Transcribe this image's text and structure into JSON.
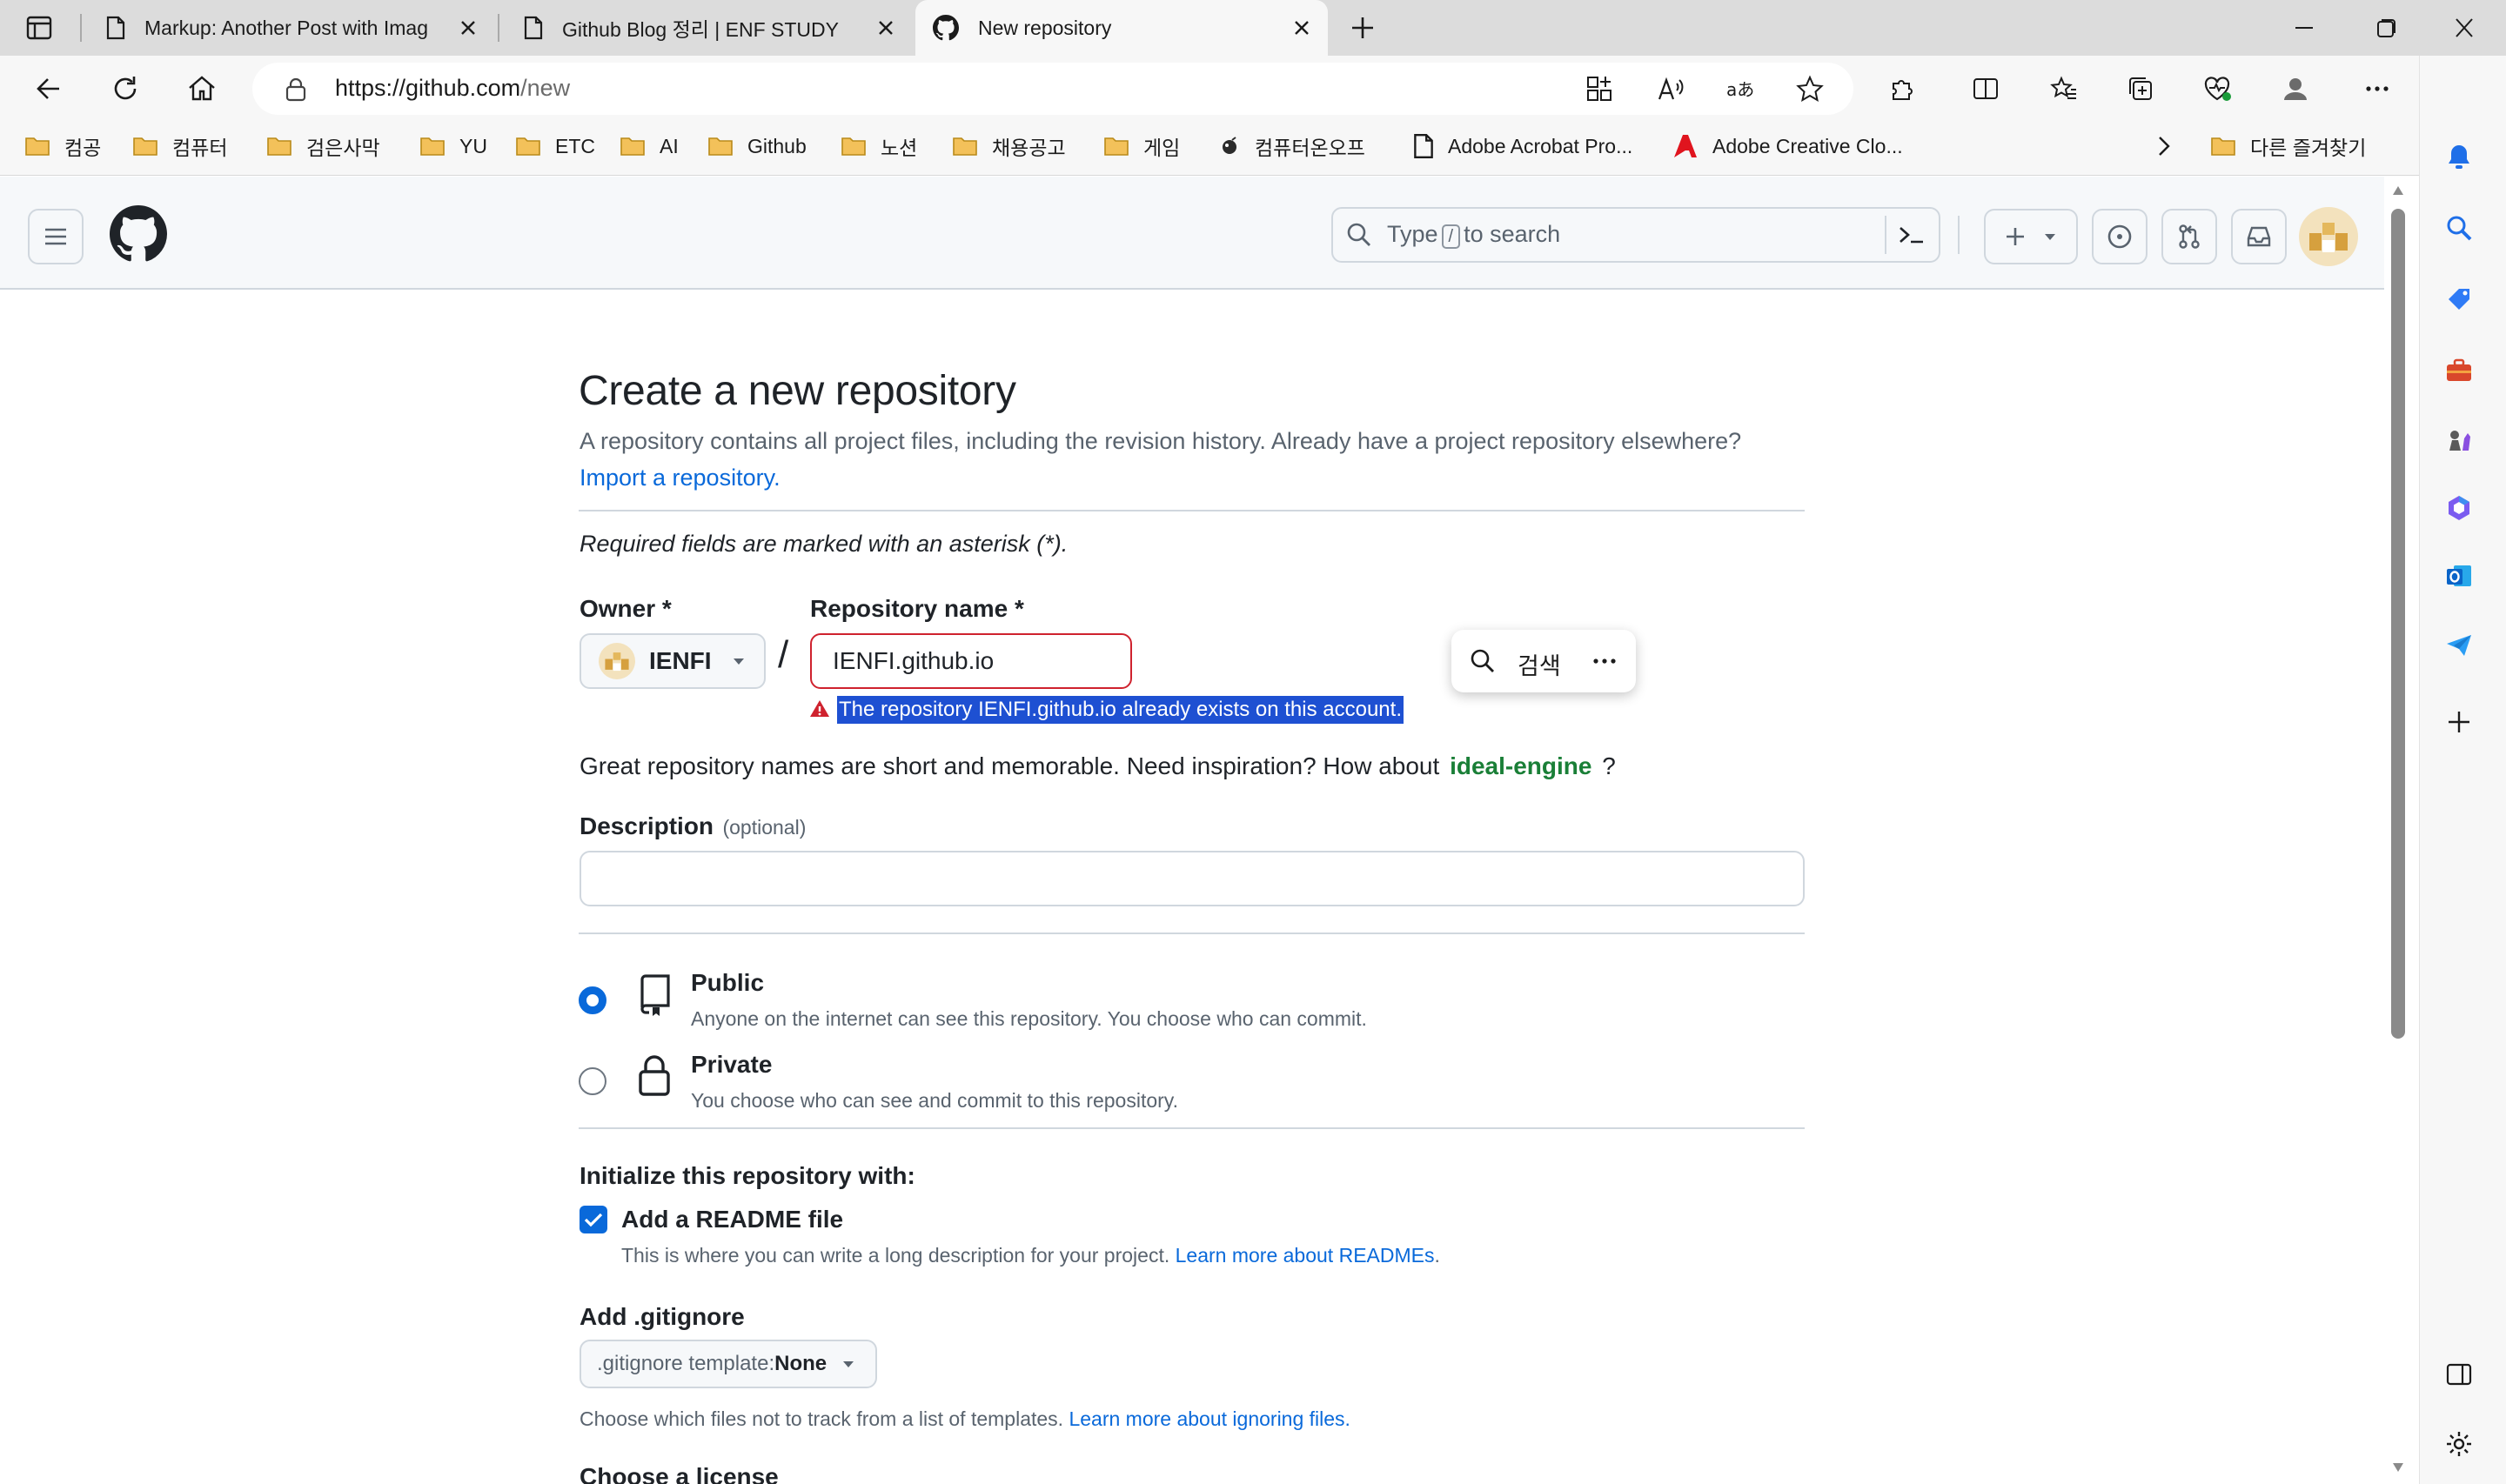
{
  "browser": {
    "tabs": [
      {
        "title": "Markup: Another Post with Imag",
        "icon": "page-icon"
      },
      {
        "title": "Github Blog 정리 | ENF STUDY",
        "icon": "page-icon"
      },
      {
        "title": "New repository",
        "icon": "github-icon",
        "active": true
      }
    ],
    "url_host": "https://github.com",
    "url_path": "/new",
    "bookmarks": [
      {
        "label": "컴공",
        "icon": "folder-icon"
      },
      {
        "label": "컴퓨터",
        "icon": "folder-icon"
      },
      {
        "label": "검은사막",
        "icon": "folder-icon"
      },
      {
        "label": "YU",
        "icon": "folder-icon"
      },
      {
        "label": "ETC",
        "icon": "folder-icon"
      },
      {
        "label": "AI",
        "icon": "folder-icon"
      },
      {
        "label": "Github",
        "icon": "folder-icon"
      },
      {
        "label": "노션",
        "icon": "folder-icon"
      },
      {
        "label": "채용공고",
        "icon": "folder-icon"
      },
      {
        "label": "게임",
        "icon": "folder-icon"
      },
      {
        "label": "컴퓨터온오프",
        "icon": "site-icon"
      },
      {
        "label": "Adobe Acrobat Pro...",
        "icon": "page-icon"
      },
      {
        "label": "Adobe Creative Clo...",
        "icon": "adobe-icon"
      }
    ],
    "other_bookmarks": "다른 즐겨찾기"
  },
  "header": {
    "search_prefix": "Type",
    "search_key": "/",
    "search_suffix": "to search"
  },
  "form": {
    "title": "Create a new repository",
    "subtitle": "A repository contains all project files, including the revision history. Already have a project repository elsewhere?",
    "import_link": "Import a repository.",
    "required_note": "Required fields are marked with an asterisk (*).",
    "owner_label": "Owner *",
    "owner_value": "IENFI",
    "repo_label": "Repository name *",
    "repo_value": "IENFI.github.io",
    "slash": "/",
    "error_message": "The repository IENFI.github.io already exists on this account.",
    "popup_search_label": "검색",
    "inspiration_text": "Great repository names are short and memorable. Need inspiration? How about",
    "suggested_name": "ideal-engine",
    "inspiration_end": "?",
    "description_label": "Description",
    "description_optional": "(optional)",
    "description_value": "",
    "visibility": [
      {
        "label": "Public",
        "desc": "Anyone on the internet can see this repository. You choose who can commit.",
        "selected": true
      },
      {
        "label": "Private",
        "desc": "You choose who can see and commit to this repository.",
        "selected": false
      }
    ],
    "init_heading": "Initialize this repository with:",
    "readme_label": "Add a README file",
    "readme_checked": true,
    "readme_desc": "This is where you can write a long description for your project.",
    "readme_link": "Learn more about READMEs",
    "readme_link_end": ".",
    "gitignore_heading": "Add .gitignore",
    "gitignore_prefix": ".gitignore template:",
    "gitignore_value": "None",
    "gitignore_desc": "Choose which files not to track from a list of templates.",
    "gitignore_link": "Learn more about ignoring files.",
    "license_heading": "Choose a license"
  },
  "colors": {
    "accent": "#0969da",
    "error": "#cf222e",
    "selection": "#1e50d2",
    "suggestion": "#1a7f37"
  }
}
